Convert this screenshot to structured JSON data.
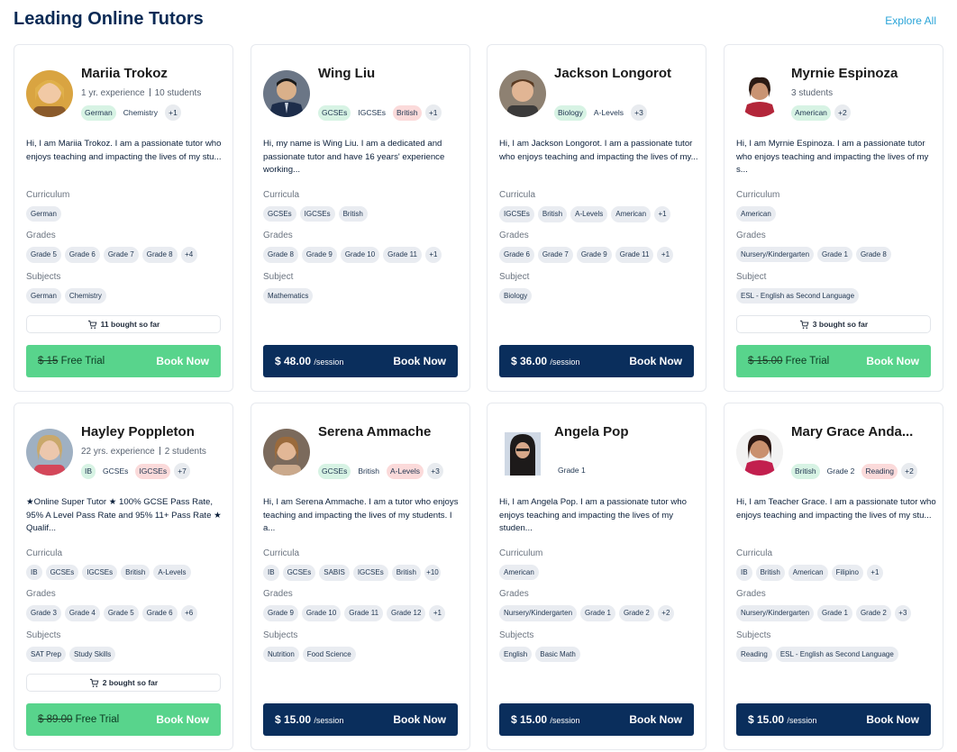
{
  "header": {
    "title": "Leading Online Tutors",
    "explore_label": "Explore All"
  },
  "labels": {
    "curriculum": "Curriculum",
    "curricula": "Curricula",
    "grades": "Grades",
    "subject": "Subject",
    "subjects": "Subjects",
    "book_now": "Book Now",
    "free_trial": "Free Trial",
    "per_session": "/session"
  },
  "icons": {
    "bought": "cart-icon"
  },
  "colors": {
    "trial_button": "#58d48c",
    "paid_button": "#0a2e5c",
    "title": "#0a2a55",
    "explore_link": "#2aa4d8"
  },
  "tutors": [
    {
      "name": "Mariia Trokoz",
      "experience": "1 yr. experience",
      "students": "10 students",
      "top_tags": [
        "German",
        "Chemistry"
      ],
      "top_tags_more": "+1",
      "bio": "Hi, I am Mariia Trokoz. I am a passionate tutor who enjoys teaching and impacting the lives of my stu...",
      "curriculum": [
        "German"
      ],
      "grades": [
        "Grade 5",
        "Grade 6",
        "Grade 7",
        "Grade 8"
      ],
      "grades_more": "+4",
      "subjects": [
        "German",
        "Chemistry"
      ],
      "bought": "11 bought so far",
      "old_price": "$ 15",
      "price": ""
    },
    {
      "name": "Wing Liu",
      "top_tags": [
        "GCSEs",
        "IGCSEs",
        "British"
      ],
      "top_tags_more": "+1",
      "bio": "Hi, my name is Wing Liu. I am a dedicated and passionate tutor and have 16 years' experience working...",
      "curriculum": [
        "GCSEs",
        "IGCSEs",
        "British"
      ],
      "grades": [
        "Grade 8",
        "Grade 9",
        "Grade 10",
        "Grade 11"
      ],
      "grades_more": "+1",
      "subjects": [
        "Mathematics"
      ],
      "price": "$ 48.00"
    },
    {
      "name": "Jackson Longorot",
      "top_tags": [
        "Biology",
        "A-Levels"
      ],
      "top_tags_more": "+3",
      "bio": "Hi, I am Jackson Longorot. I am a passionate tutor who enjoys teaching and impacting the lives of my...",
      "curriculum": [
        "IGCSEs",
        "British",
        "A-Levels",
        "American"
      ],
      "curriculum_more": "+1",
      "grades": [
        "Grade 6",
        "Grade 7",
        "Grade 9",
        "Grade 11"
      ],
      "grades_more": "+1",
      "subjects": [
        "Biology"
      ],
      "price": "$ 36.00"
    },
    {
      "name": "Myrnie Espinoza",
      "students": "3 students",
      "top_tags": [
        "American"
      ],
      "top_tags_more": "+2",
      "bio": "Hi, I am Myrnie Espinoza. I am a passionate tutor who enjoys teaching and impacting the lives of my s...",
      "curriculum": [
        "American"
      ],
      "grades": [
        "Nursery/Kindergarten",
        "Grade 1",
        "Grade 8"
      ],
      "subjects": [
        "ESL - English as Second Language"
      ],
      "bought": "3 bought so far",
      "old_price": "$ 15.00"
    },
    {
      "name": "Hayley Poppleton",
      "experience": "22 yrs. experience",
      "students": "2 students",
      "top_tags": [
        "IB",
        "GCSEs",
        "IGCSEs"
      ],
      "top_tags_more": "+7",
      "bio": "★Online Super Tutor ★ 100% GCSE Pass Rate, 95% A Level Pass Rate and 95% 11+ Pass Rate ★ Qualif...",
      "curriculum": [
        "IB",
        "GCSEs",
        "IGCSEs",
        "British",
        "A-Levels"
      ],
      "grades": [
        "Grade 3",
        "Grade 4",
        "Grade 5",
        "Grade 6"
      ],
      "grades_more": "+6",
      "subjects": [
        "SAT Prep",
        "Study Skills"
      ],
      "bought": "2 bought so far",
      "old_price": "$ 89.00"
    },
    {
      "name": "Serena Ammache",
      "top_tags": [
        "GCSEs",
        "British",
        "A-Levels"
      ],
      "top_tags_more": "+3",
      "bio": "Hi, I am Serena Ammache. I am a tutor who enjoys teaching and impacting the lives of my students. I a...",
      "curriculum": [
        "IB",
        "GCSEs",
        "SABIS",
        "IGCSEs",
        "British"
      ],
      "curriculum_more": "+10",
      "grades": [
        "Grade 9",
        "Grade 10",
        "Grade 11",
        "Grade 12"
      ],
      "grades_more": "+1",
      "subjects": [
        "Nutrition",
        "Food Science"
      ],
      "price": "$ 15.00"
    },
    {
      "name": "Angela Pop",
      "top_tags": [
        "Grade 1"
      ],
      "bio": "Hi, I am Angela Pop. I am a passionate tutor who enjoys teaching and impacting the lives of my studen...",
      "curriculum": [
        "American"
      ],
      "grades": [
        "Nursery/Kindergarten",
        "Grade 1",
        "Grade 2"
      ],
      "grades_more": "+2",
      "subjects": [
        "English",
        "Basic Math"
      ],
      "price": "$ 15.00"
    },
    {
      "name": "Mary Grace Anda...",
      "top_tags": [
        "British",
        "Grade 2",
        "Reading"
      ],
      "top_tags_more": "+2",
      "bio": "Hi, I am Teacher Grace. I am a passionate tutor who enjoys teaching and impacting the lives of my stu...",
      "curriculum": [
        "IB",
        "British",
        "American",
        "Filipino"
      ],
      "curriculum_more": "+1",
      "grades": [
        "Nursery/Kindergarten",
        "Grade 1",
        "Grade 2"
      ],
      "grades_more": "+3",
      "subjects": [
        "Reading",
        "ESL - English as Second Language"
      ],
      "price": "$ 15.00"
    }
  ]
}
